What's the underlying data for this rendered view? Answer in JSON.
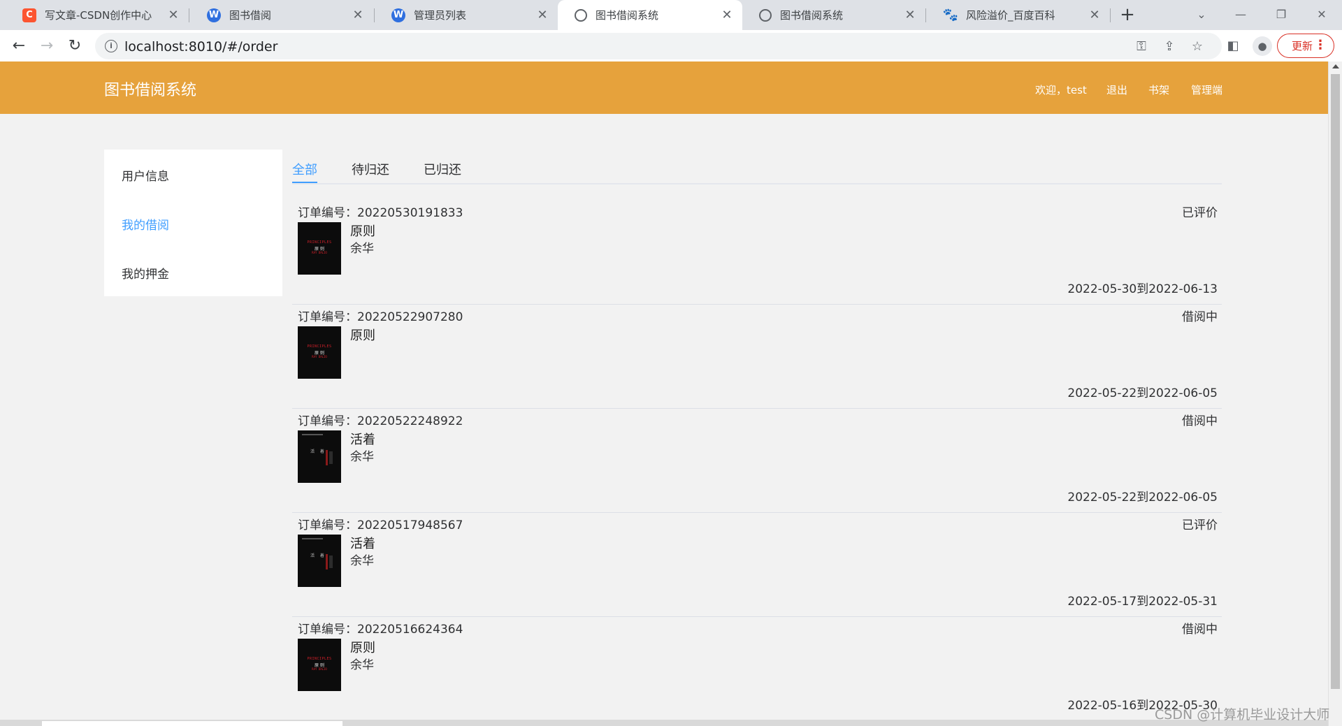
{
  "browser": {
    "tabs": [
      {
        "title": "写文章-CSDN创作中心",
        "icon": "csdn-icon"
      },
      {
        "title": "图书借阅",
        "icon": "w-icon"
      },
      {
        "title": "管理员列表",
        "icon": "w-icon"
      },
      {
        "title": "图书借阅系统",
        "icon": "globe-icon",
        "active": true
      },
      {
        "title": "图书借阅系统",
        "icon": "globe-icon"
      },
      {
        "title": "风险溢价_百度百科",
        "icon": "baidu-paw-icon"
      }
    ],
    "url": "localhost:8010/#/order",
    "update_label": "更新"
  },
  "header": {
    "title": "图书借阅系统",
    "welcome": "欢迎，test",
    "logout": "退出",
    "bookshelf": "书架",
    "admin": "管理端",
    "bg_color": "#e6a23c"
  },
  "sidebar": {
    "items": [
      {
        "label": "用户信息"
      },
      {
        "label": "我的借阅",
        "active": true
      },
      {
        "label": "我的押金"
      }
    ]
  },
  "tabs": {
    "items": [
      {
        "label": "全部",
        "active": true
      },
      {
        "label": "待归还"
      },
      {
        "label": "已归还"
      }
    ],
    "accent_color": "#409eff"
  },
  "orders": [
    {
      "order_no": "订单编号：20220530191833",
      "status": "已评价",
      "book_title": "原则",
      "author": "余华",
      "dates": "2022-05-30到2022-06-13",
      "cover": "principles"
    },
    {
      "order_no": "订单编号：20220522907280",
      "status": "借阅中",
      "book_title": "原则",
      "author": "",
      "dates": "2022-05-22到2022-06-05",
      "cover": "principles"
    },
    {
      "order_no": "订单编号：20220522248922",
      "status": "借阅中",
      "book_title": "活着",
      "author": "余华",
      "dates": "2022-05-22到2022-06-05",
      "cover": "to-live"
    },
    {
      "order_no": "订单编号：20220517948567",
      "status": "已评价",
      "book_title": "活着",
      "author": "余华",
      "dates": "2022-05-17到2022-05-31",
      "cover": "to-live"
    },
    {
      "order_no": "订单编号：20220516624364",
      "status": "借阅中",
      "book_title": "原则",
      "author": "余华",
      "dates": "2022-05-16到2022-05-30",
      "cover": "principles"
    }
  ],
  "cover_text": {
    "principles_title": "PRINCIPLES",
    "principles_cn": "原 则",
    "principles_author": "RAY DALIO",
    "to_live_cn": "活 着"
  },
  "watermark": "CSDN @计算机毕业设计大师"
}
